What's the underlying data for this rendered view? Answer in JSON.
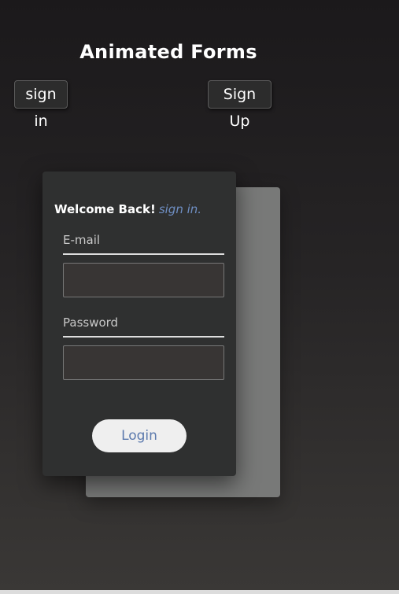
{
  "header": {
    "title": "Animated Forms"
  },
  "toggles": {
    "sign_in_label": "sign in",
    "sign_up_label": "Sign Up"
  },
  "form": {
    "welcome_text": "Welcome Back!",
    "welcome_link": "sign in.",
    "email_label": "E-mail",
    "email_value": "",
    "password_label": "Password",
    "password_value": "",
    "login_label": "Login"
  },
  "colors": {
    "background_top": "#1b191b",
    "background_bottom": "#3a3836",
    "front_card": "#2f3030",
    "back_card": "#787978",
    "link_accent": "#6f8fc4",
    "login_text": "#5b79ad",
    "login_button_bg": "#efefef"
  }
}
